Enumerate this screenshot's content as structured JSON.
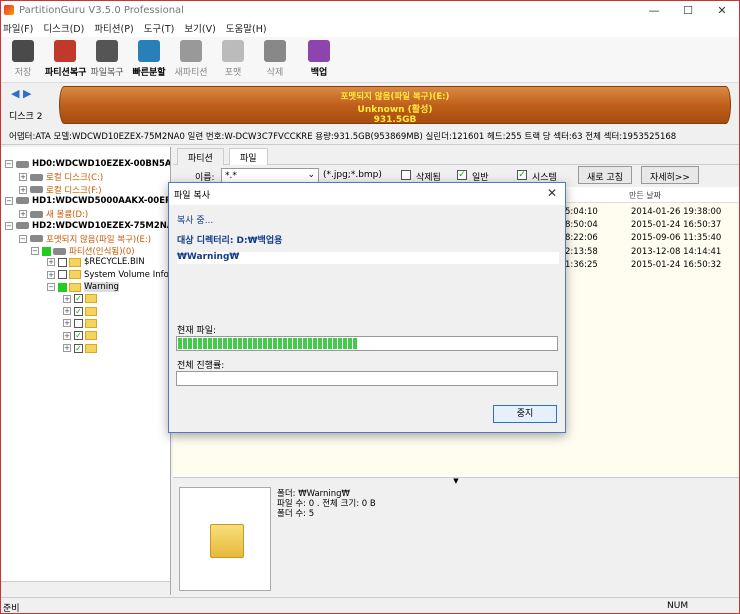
{
  "window": {
    "title": "PartitionGuru V3.5.0 Professional"
  },
  "menu": [
    "파일(F)",
    "디스크(D)",
    "파티션(P)",
    "도구(T)",
    "보기(V)",
    "도움말(H)"
  ],
  "toolbar": [
    {
      "label": "저장",
      "icon": "save-icon",
      "color": "#4a4a4a",
      "style": "dim"
    },
    {
      "label": "파티션복구",
      "icon": "search-icon",
      "color": "#c0392b",
      "style": "bold"
    },
    {
      "label": "파일복구",
      "icon": "recover-icon",
      "color": "#555555",
      "style": "normal"
    },
    {
      "label": "빠른분할",
      "icon": "quick-partition-icon",
      "color": "#2980b9",
      "style": "bold"
    },
    {
      "label": "새파티션",
      "icon": "new-partition-icon",
      "color": "#999999",
      "style": "dim"
    },
    {
      "label": "포맷",
      "icon": "format-icon",
      "color": "#bbbbbb",
      "style": "dim"
    },
    {
      "label": "삭제",
      "icon": "delete-icon",
      "color": "#888888",
      "style": "dim"
    },
    {
      "label": "백업",
      "icon": "backup-icon",
      "color": "#8e44ad",
      "style": "bold"
    }
  ],
  "disk_bar": {
    "disk_label": "디스크",
    "disk_number": "2",
    "partition_status": "포맷되지 않음(파일 복구)(E:)",
    "fs": "Unknown (활성)",
    "size": "931.5GB",
    "info": "어댑터:ATA  모델:WDCWD10EZEX-75M2NA0  일련 번호:W-DCW3C7FVCCKRE  용량:931.5GB(953869MB)  실린더:121601  헤드:255  트랙 당 섹터:63  전체 섹터:1953525168"
  },
  "tree": [
    {
      "label": "HD0:WDCWD10EZEX-00BN5A",
      "level": 0,
      "type": "disk",
      "bold": true
    },
    {
      "label": "로컬 디스크(C:)",
      "level": 1,
      "type": "part",
      "orange": true
    },
    {
      "label": "로컬 디스크(F:)",
      "level": 1,
      "type": "part",
      "orange": true
    },
    {
      "label": "HD1:WDCWD5000AAKX-00ER",
      "level": 0,
      "type": "disk",
      "bold": true
    },
    {
      "label": "새 볼륨(D:)",
      "level": 1,
      "type": "part",
      "orange": true
    },
    {
      "label": "HD2:WDCWD10EZEX-75M2NA",
      "level": 0,
      "type": "disk",
      "bold": true
    },
    {
      "label": "포맷되지 않음(파일 복구)(E:)",
      "level": 1,
      "type": "part",
      "orange": true
    },
    {
      "label": "파티션(인식됨)(0)",
      "level": 2,
      "type": "recognized",
      "orange": true
    },
    {
      "label": "$RECYCLE.BIN",
      "level": 3,
      "type": "folder"
    },
    {
      "label": "System Volume Inform",
      "level": 3,
      "type": "folder"
    },
    {
      "label": "Warning",
      "level": 3,
      "type": "folder",
      "selected": true
    },
    {
      "label": "",
      "level": 4,
      "type": "folder",
      "checked": true
    },
    {
      "label": "",
      "level": 4,
      "type": "folder",
      "checked": true
    },
    {
      "label": "",
      "level": 4,
      "type": "folder",
      "checked": false
    },
    {
      "label": "",
      "level": 4,
      "type": "folder",
      "checked": true
    },
    {
      "label": "",
      "level": 4,
      "type": "folder",
      "checked": true
    }
  ],
  "tabs": [
    "파티션",
    "파일"
  ],
  "filter": {
    "name_label": "이름:",
    "name_value": "*.*",
    "hint": "(*.jpg;*.bmp)",
    "deleted_label": "삭제됨",
    "normal_label": "일반",
    "system_label": "시스템",
    "refresh": "새로 고침",
    "details": "자세히>>"
  },
  "columns": {
    "created": "만든 날짜"
  },
  "files": [
    {
      "c1": "5:04:10",
      "c2": "2014-01-26 19:38:00"
    },
    {
      "c1": "8:50:04",
      "c2": "2015-01-24 16:50:37"
    },
    {
      "c1": "8:22:06",
      "c2": "2015-09-06 11:35:40"
    },
    {
      "c1": "2:13:58",
      "c2": "2013-12-08 14:14:41"
    },
    {
      "c1": "1:36:25",
      "c2": "2015-01-24 16:50:32"
    }
  ],
  "preview": {
    "folder": "폴더: ₩Warning₩",
    "stats": "파일 수: 0 . 전체 크기: 0 B",
    "folders": "폴더 수: 5"
  },
  "status": {
    "left": "준비",
    "num": "NUM"
  },
  "dialog": {
    "title": "파일 복사",
    "copying": "복사 중...",
    "destination": "대상 디렉터리: D:₩백업용",
    "path": "₩Warning₩",
    "current_file_label": "현재 파일:",
    "current_progress": 0.47,
    "total_label": "전체 진행률:",
    "total_progress": 0.0,
    "stop": "중지"
  }
}
